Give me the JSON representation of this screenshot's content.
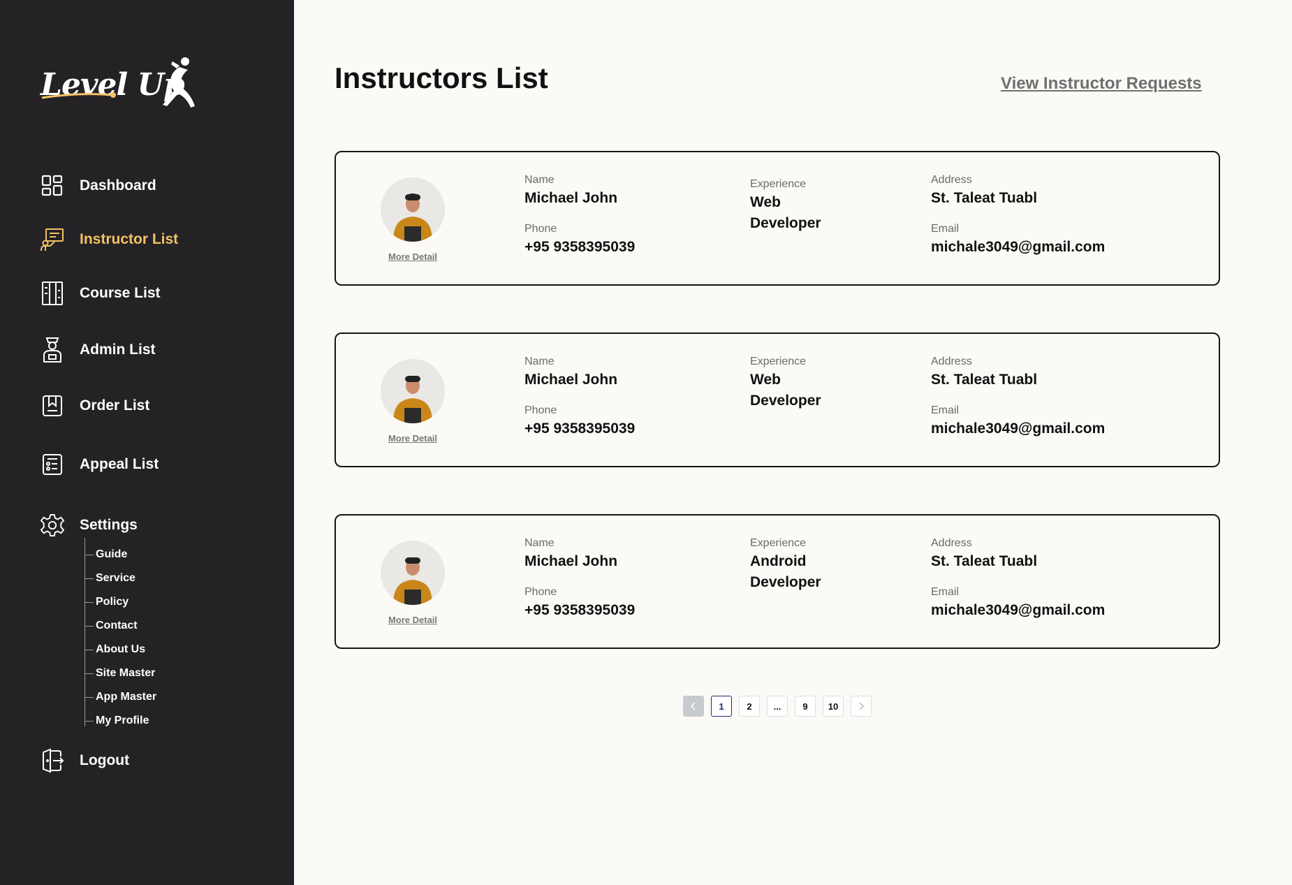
{
  "brand": {
    "logo_text": "Level Up"
  },
  "sidebar": {
    "items": [
      {
        "label": "Dashboard"
      },
      {
        "label": "Instructor List"
      },
      {
        "label": "Course List"
      },
      {
        "label": "Admin List"
      },
      {
        "label": "Order List"
      },
      {
        "label": "Appeal List"
      },
      {
        "label": "Settings"
      },
      {
        "label": "Logout"
      }
    ],
    "active_item": "Instructor List",
    "settings_submenu": [
      {
        "label": "Guide"
      },
      {
        "label": "Service"
      },
      {
        "label": "Policy"
      },
      {
        "label": "Contact"
      },
      {
        "label": "About Us"
      },
      {
        "label": "Site Master"
      },
      {
        "label": "App Master"
      },
      {
        "label": "My Profile"
      }
    ]
  },
  "main": {
    "title": "Instructors List",
    "requests_link": "View  Instructor Requests",
    "field_labels": {
      "name": "Name",
      "experience": "Experience",
      "address": "Address",
      "phone": "Phone",
      "email": "Email"
    },
    "more_detail_label": "More Detail",
    "instructors": [
      {
        "name": "Michael John",
        "experience": "Web Developer",
        "address": "St.  Taleat Tuabl",
        "phone": "+95 9358395039",
        "email": "michale3049@gmail.com"
      },
      {
        "name": "Michael John",
        "experience": "Web Developer",
        "address": "St.  Taleat Tuabl",
        "phone": "+95 9358395039",
        "email": "michale3049@gmail.com"
      },
      {
        "name": "Michael John",
        "experience": "Android Developer",
        "address": "St.  Taleat Tuabl",
        "phone": "+95 9358395039",
        "email": "michale3049@gmail.com"
      }
    ]
  },
  "pagination": {
    "pages": [
      "1",
      "2",
      "...",
      "9",
      "10"
    ],
    "current": "1"
  },
  "colors": {
    "sidebar_bg": "#252225",
    "accent": "#f2c266",
    "page_bg": "#fcfaf6",
    "pagination_active": "#1e2c6b"
  }
}
